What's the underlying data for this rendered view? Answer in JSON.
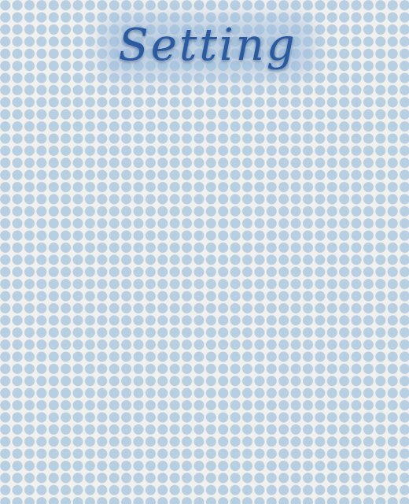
{
  "screen": {
    "title": "Setting"
  },
  "colors": {
    "background": "#f0f0ee",
    "dot": "#b8cfe2",
    "title": "#2a5aa0"
  }
}
